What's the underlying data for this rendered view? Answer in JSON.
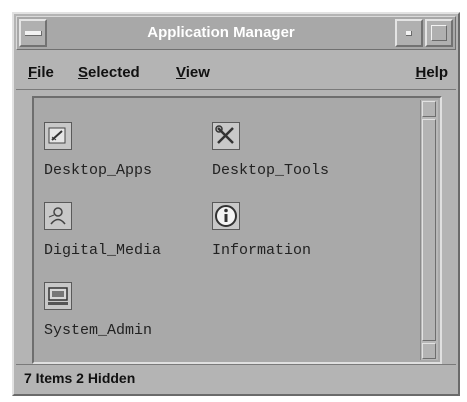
{
  "window": {
    "title": "Application Manager"
  },
  "menu": {
    "file": {
      "mnemonic": "F",
      "rest": "ile"
    },
    "selected": {
      "mnemonic": "S",
      "rest": "elected"
    },
    "view": {
      "mnemonic": "V",
      "rest": "iew"
    },
    "help": {
      "mnemonic": "H",
      "rest": "elp"
    }
  },
  "icons": [
    {
      "label": "Desktop_Apps",
      "icon": "desktop-apps-icon"
    },
    {
      "label": "Desktop_Tools",
      "icon": "desktop-tools-icon"
    },
    {
      "label": "Digital_Media",
      "icon": "digital-media-icon"
    },
    {
      "label": "Information",
      "icon": "information-icon"
    },
    {
      "label": "System_Admin",
      "icon": "system-admin-icon"
    }
  ],
  "status": {
    "text": "7 Items 2 Hidden"
  }
}
